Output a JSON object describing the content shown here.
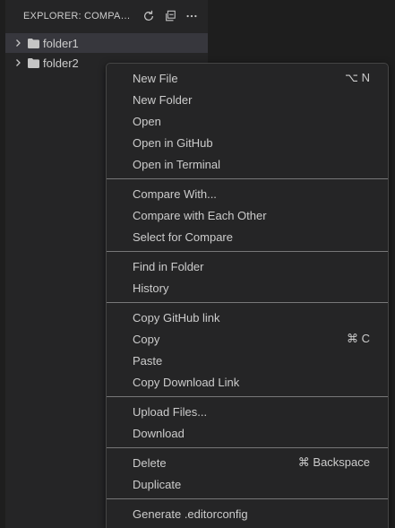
{
  "explorer": {
    "title": "EXPLORER: COMPAR...",
    "actions": [
      {
        "icon": "refresh-icon"
      },
      {
        "icon": "collapse-all-icon"
      },
      {
        "icon": "more-icon"
      }
    ]
  },
  "tree": [
    {
      "label": "folder1",
      "icon": "folder-icon",
      "selected": true
    },
    {
      "label": "folder2",
      "icon": "folder-icon",
      "selected": false
    }
  ],
  "context_menu": {
    "groups": [
      [
        {
          "label": "New File",
          "shortcut": "⌥ N"
        },
        {
          "label": "New Folder",
          "shortcut": ""
        },
        {
          "label": "Open",
          "shortcut": ""
        },
        {
          "label": "Open in GitHub",
          "shortcut": ""
        },
        {
          "label": "Open in Terminal",
          "shortcut": ""
        }
      ],
      [
        {
          "label": "Compare With...",
          "shortcut": ""
        },
        {
          "label": "Compare with Each Other",
          "shortcut": ""
        },
        {
          "label": "Select for Compare",
          "shortcut": ""
        }
      ],
      [
        {
          "label": "Find in Folder",
          "shortcut": ""
        },
        {
          "label": "History",
          "shortcut": ""
        }
      ],
      [
        {
          "label": "Copy GitHub link",
          "shortcut": ""
        },
        {
          "label": "Copy",
          "shortcut": "⌘ C"
        },
        {
          "label": "Paste",
          "shortcut": ""
        },
        {
          "label": "Copy Download Link",
          "shortcut": ""
        }
      ],
      [
        {
          "label": "Upload Files...",
          "shortcut": ""
        },
        {
          "label": "Download",
          "shortcut": ""
        }
      ],
      [
        {
          "label": "Delete",
          "shortcut": "⌘ Backspace"
        },
        {
          "label": "Duplicate",
          "shortcut": ""
        }
      ],
      [
        {
          "label": "Generate .editorconfig",
          "shortcut": ""
        }
      ]
    ]
  },
  "colors": {
    "background": "#1e1e1e",
    "sidebar": "#252526",
    "selected_row": "#37373d",
    "text": "#cccccc",
    "menu_border": "#454545"
  }
}
